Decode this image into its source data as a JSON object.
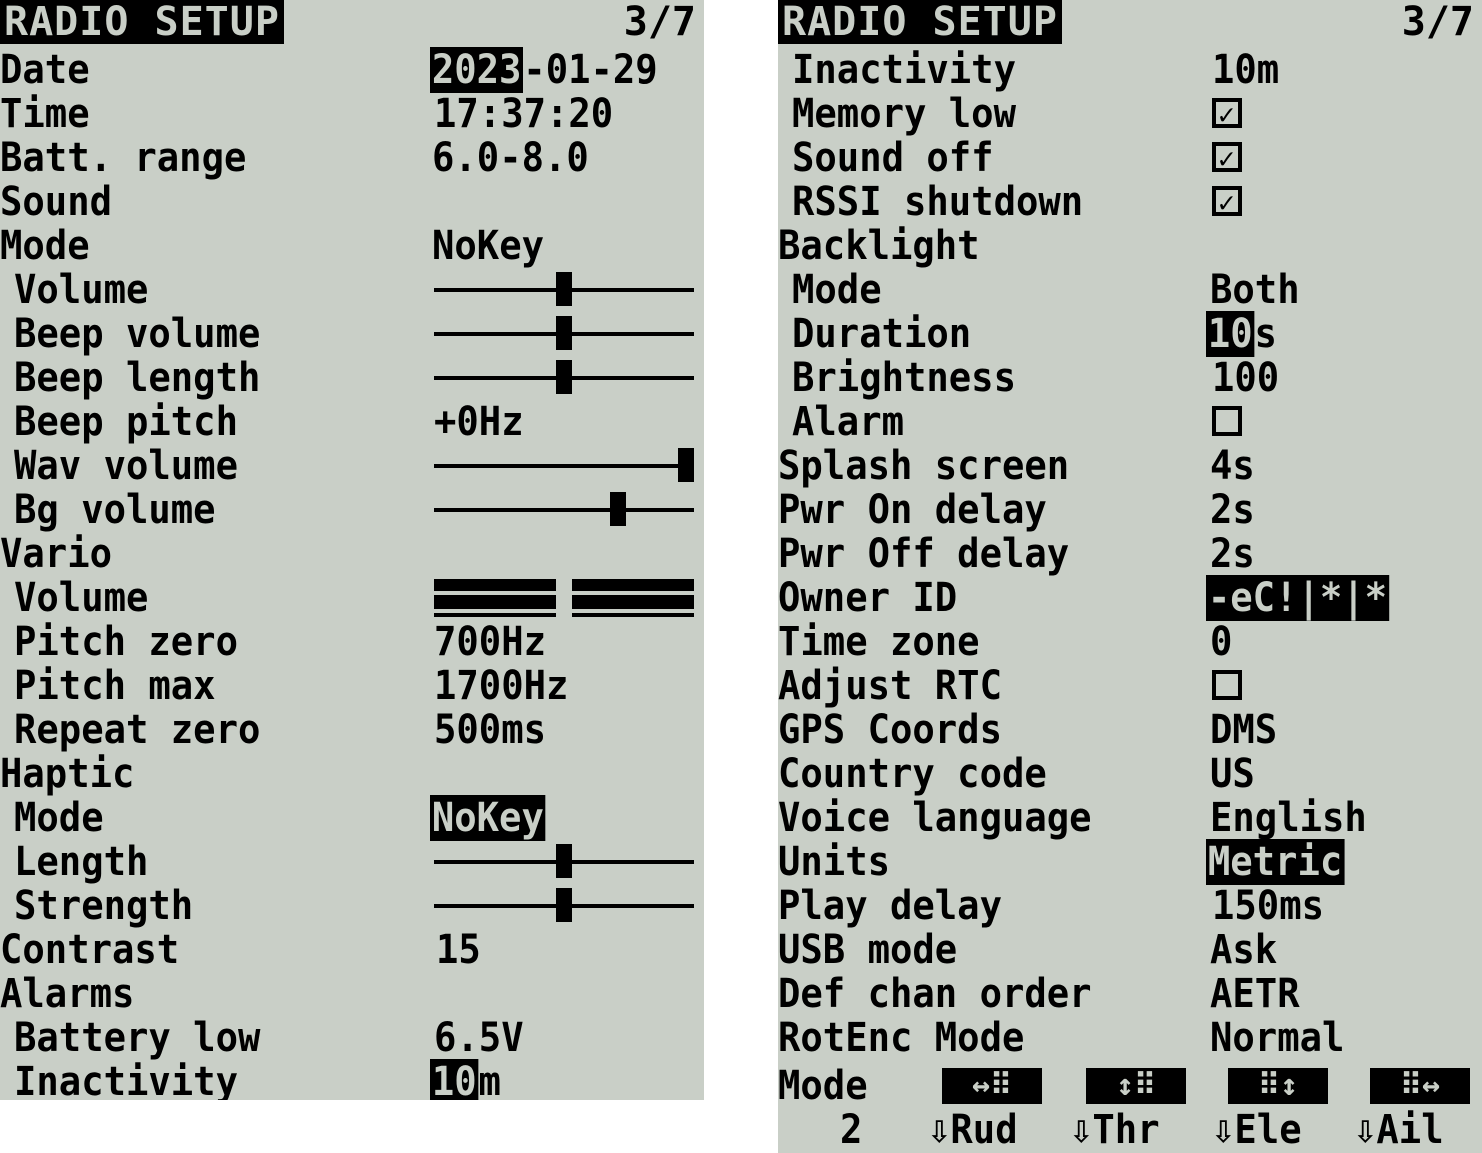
{
  "left": {
    "title": "RADIO SETUP",
    "page": "3/7",
    "date": {
      "label": "Date",
      "year": "2023",
      "rest": "-01-29"
    },
    "time": {
      "label": "Time",
      "value": "17:37:20"
    },
    "batt_range": {
      "label": "Batt. range",
      "value": "6.0-8.0"
    },
    "sound_header": "Sound",
    "sound_mode": {
      "label": "Mode",
      "value": "NoKey"
    },
    "volume": {
      "label": "Volume",
      "level": 0.5
    },
    "beep_volume": {
      "label": "Beep volume",
      "level": 0.5
    },
    "beep_length": {
      "label": "Beep length",
      "level": 0.5
    },
    "beep_pitch": {
      "label": "Beep pitch",
      "value": "+0Hz"
    },
    "wav_volume": {
      "label": "Wav volume",
      "level": 1.0
    },
    "bg_volume": {
      "label": "Bg volume",
      "level": 0.72
    },
    "vario_header": "Vario",
    "vario_volume": {
      "label": "Volume",
      "level": 0.5
    },
    "pitch_zero": {
      "label": "Pitch zero",
      "value": "700Hz"
    },
    "pitch_max": {
      "label": "Pitch max",
      "value": "1700Hz"
    },
    "repeat_zero": {
      "label": "Repeat zero",
      "value": "500ms"
    },
    "haptic_header": "Haptic",
    "haptic_mode": {
      "label": "Mode",
      "value": "NoKey"
    },
    "haptic_length": {
      "label": "Length",
      "level": 0.5
    },
    "haptic_strength": {
      "label": "Strength",
      "level": 0.5
    },
    "contrast": {
      "label": "Contrast",
      "value": "15"
    },
    "alarms_header": "Alarms",
    "battery_low": {
      "label": "Battery low",
      "value": "6.5V"
    },
    "inactivity": {
      "label": "Inactivity",
      "value_hl": "10",
      "value_rest": "m"
    }
  },
  "right": {
    "title": "RADIO SETUP",
    "page": "3/7",
    "inactivity": {
      "label": "Inactivity",
      "value": "10m"
    },
    "memory_low": {
      "label": "Memory low",
      "checked": true
    },
    "sound_off": {
      "label": "Sound off",
      "checked": true
    },
    "rssi_shutdown": {
      "label": "RSSI shutdown",
      "checked": true
    },
    "backlight_header": "Backlight",
    "bl_mode": {
      "label": "Mode",
      "value": "Both"
    },
    "bl_duration": {
      "label": "Duration",
      "value_hl": "10",
      "value_rest": "s"
    },
    "bl_brightness": {
      "label": "Brightness",
      "value": "100"
    },
    "bl_alarm": {
      "label": "Alarm",
      "checked": false
    },
    "splash_screen": {
      "label": "Splash screen",
      "value": "4s"
    },
    "pwr_on_delay": {
      "label": "Pwr On delay",
      "value": "2s"
    },
    "pwr_off_delay": {
      "label": "Pwr Off delay",
      "value": "2s"
    },
    "owner_id": {
      "label": "Owner ID",
      "value": "-eC!|*|*"
    },
    "time_zone": {
      "label": "Time zone",
      "value": "0"
    },
    "adjust_rtc": {
      "label": "Adjust RTC",
      "checked": false
    },
    "gps_coords": {
      "label": "GPS Coords",
      "value": "DMS"
    },
    "country_code": {
      "label": "Country code",
      "value": "US"
    },
    "voice_language": {
      "label": "Voice language",
      "value": "English"
    },
    "units": {
      "label": "Units",
      "value": "Metric"
    },
    "play_delay": {
      "label": "Play delay",
      "value": "150ms"
    },
    "usb_mode": {
      "label": "USB mode",
      "value": "Ask"
    },
    "def_chan_order": {
      "label": "Def chan order",
      "value": "AETR"
    },
    "rotenc_mode": {
      "label": "RotEnc Mode",
      "value": "Normal"
    },
    "stick_mode": {
      "label": "Mode",
      "number": "2",
      "icons": [
        "↔⠿",
        "↕⠿",
        "⠿↕",
        "⠿↔"
      ],
      "channels": [
        "⇩Rud",
        "⇩Thr",
        "⇩Ele",
        "⇩Ail"
      ]
    }
  }
}
